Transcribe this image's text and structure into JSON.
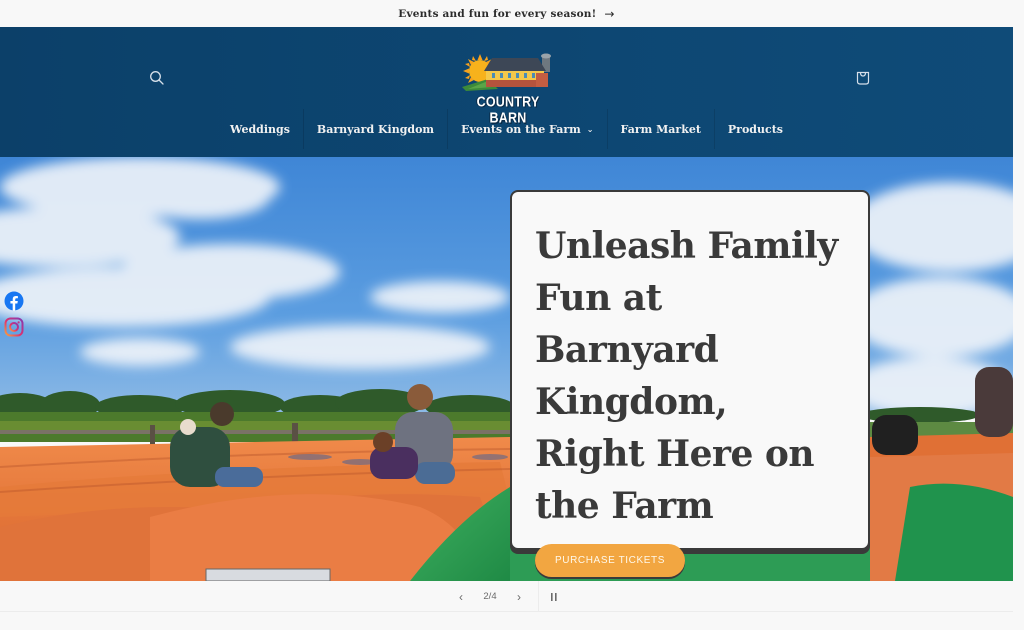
{
  "announcement": {
    "text": "Events and fun for every season!",
    "arrow_icon": "arrow-right-icon"
  },
  "header": {
    "search_icon": "search-icon",
    "cart_icon": "cart-bag-icon",
    "logo": {
      "text": "COUNTRY BARN",
      "icon": "barn-sun-logo"
    },
    "nav": [
      {
        "label": "Weddings"
      },
      {
        "label": "Barnyard Kingdom"
      },
      {
        "label": "Events on the Farm",
        "has_dropdown": true
      },
      {
        "label": "Farm Market"
      },
      {
        "label": "Products"
      }
    ],
    "dropdown_icon": "⌄"
  },
  "hero": {
    "heading": "Unleash Family Fun at Barnyard Kingdom, Right Here on the Farm",
    "cta_label": "PURCHASE TICKETS",
    "image_desc": "Families playing on an orange and green inflatable jump pad under a blue cloudy sky",
    "social": [
      {
        "name": "facebook",
        "icon": "facebook-icon"
      },
      {
        "name": "instagram",
        "icon": "instagram-icon"
      }
    ]
  },
  "slideshow": {
    "prev_glyph": "‹",
    "counter": "2/4",
    "next_glyph": "›",
    "pause_glyph": "❙❙",
    "current": 2,
    "total": 4
  },
  "colors": {
    "header_bg": "#0d4571",
    "cta_bg": "#f2a641",
    "card_border": "#3a3a3a",
    "page_bg": "#f8f8f8"
  }
}
